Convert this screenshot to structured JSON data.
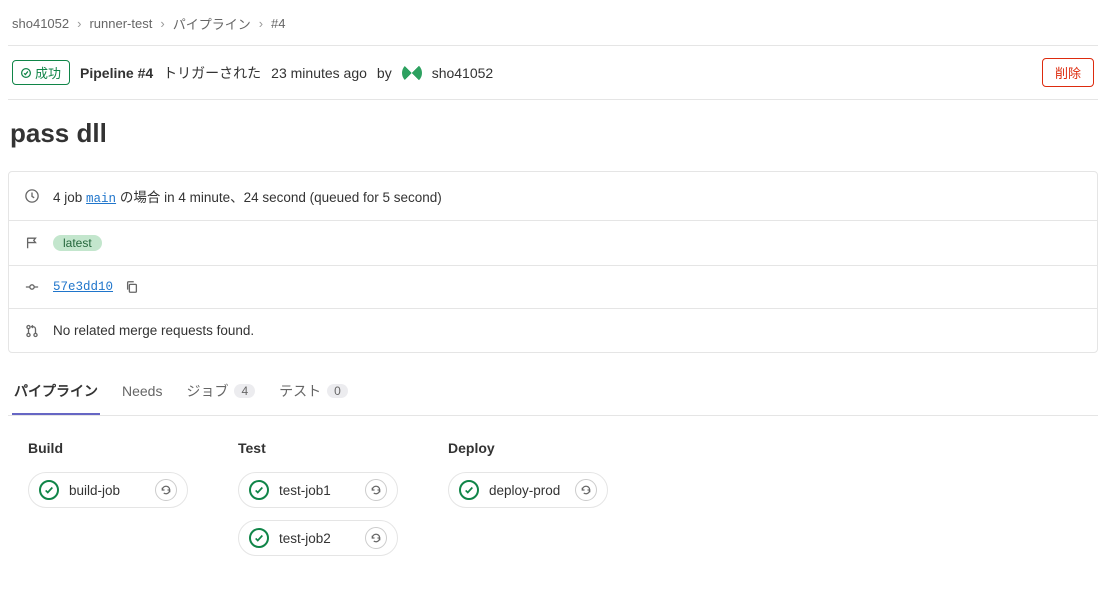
{
  "breadcrumb": {
    "owner": "sho41052",
    "project": "runner-test",
    "section": "パイプライン",
    "id": "#4"
  },
  "status": {
    "label": "成功",
    "pipeline_prefix": "Pipeline #4",
    "triggered": "トリガーされた",
    "time": "23 minutes ago",
    "by": "by",
    "user": "sho41052",
    "delete": "削除"
  },
  "title": "pass dll",
  "info": {
    "jobs_count": "4 job",
    "branch": "main",
    "duration_text": "の場合 in 4 minute、24 second (queued for 5 second)",
    "latest": "latest",
    "commit": "57e3dd10",
    "no_mr": "No related merge requests found."
  },
  "tabs": {
    "pipeline": "パイプライン",
    "needs": "Needs",
    "jobs": "ジョブ",
    "jobs_count": "4",
    "tests": "テスト",
    "tests_count": "0"
  },
  "stages": [
    {
      "name": "Build",
      "jobs": [
        "build-job"
      ]
    },
    {
      "name": "Test",
      "jobs": [
        "test-job1",
        "test-job2"
      ]
    },
    {
      "name": "Deploy",
      "jobs": [
        "deploy-prod"
      ]
    }
  ]
}
